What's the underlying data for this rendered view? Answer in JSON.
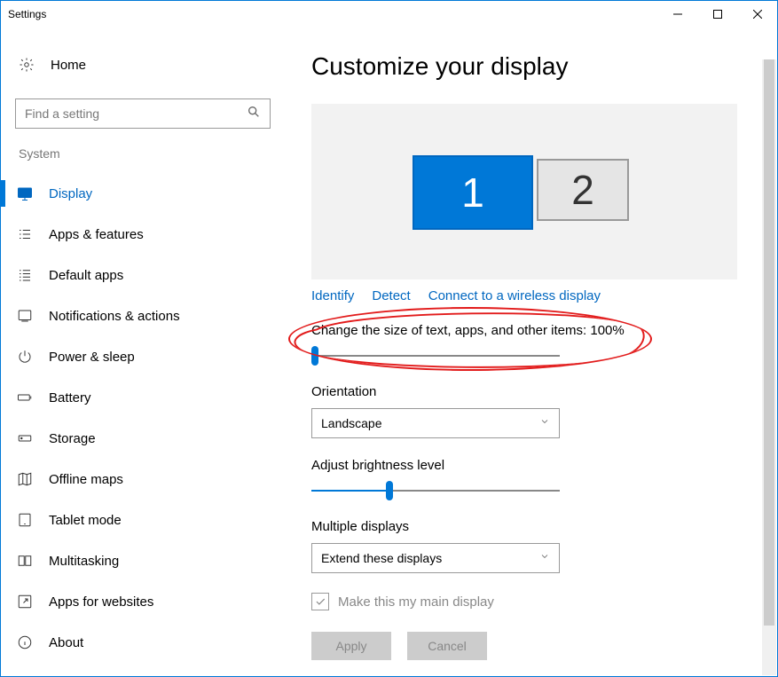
{
  "window": {
    "title": "Settings"
  },
  "sidebar": {
    "home": "Home",
    "search_placeholder": "Find a setting",
    "section": "System",
    "items": [
      {
        "label": "Display"
      },
      {
        "label": "Apps & features"
      },
      {
        "label": "Default apps"
      },
      {
        "label": "Notifications & actions"
      },
      {
        "label": "Power & sleep"
      },
      {
        "label": "Battery"
      },
      {
        "label": "Storage"
      },
      {
        "label": "Offline maps"
      },
      {
        "label": "Tablet mode"
      },
      {
        "label": "Multitasking"
      },
      {
        "label": "Apps for websites"
      },
      {
        "label": "About"
      }
    ]
  },
  "main": {
    "title": "Customize your display",
    "monitors": {
      "primary": "1",
      "secondary": "2"
    },
    "links": {
      "identify": "Identify",
      "detect": "Detect",
      "wireless": "Connect to a wireless display"
    },
    "scale": {
      "label": "Change the size of text, apps, and other items: 100%",
      "value_percent": 0
    },
    "orientation": {
      "label": "Orientation",
      "value": "Landscape"
    },
    "brightness": {
      "label": "Adjust brightness level",
      "value_percent": 30
    },
    "multiple": {
      "label": "Multiple displays",
      "value": "Extend these displays"
    },
    "main_display_checkbox": {
      "label": "Make this my main display",
      "checked": true,
      "disabled": true
    },
    "buttons": {
      "apply": "Apply",
      "cancel": "Cancel"
    }
  }
}
